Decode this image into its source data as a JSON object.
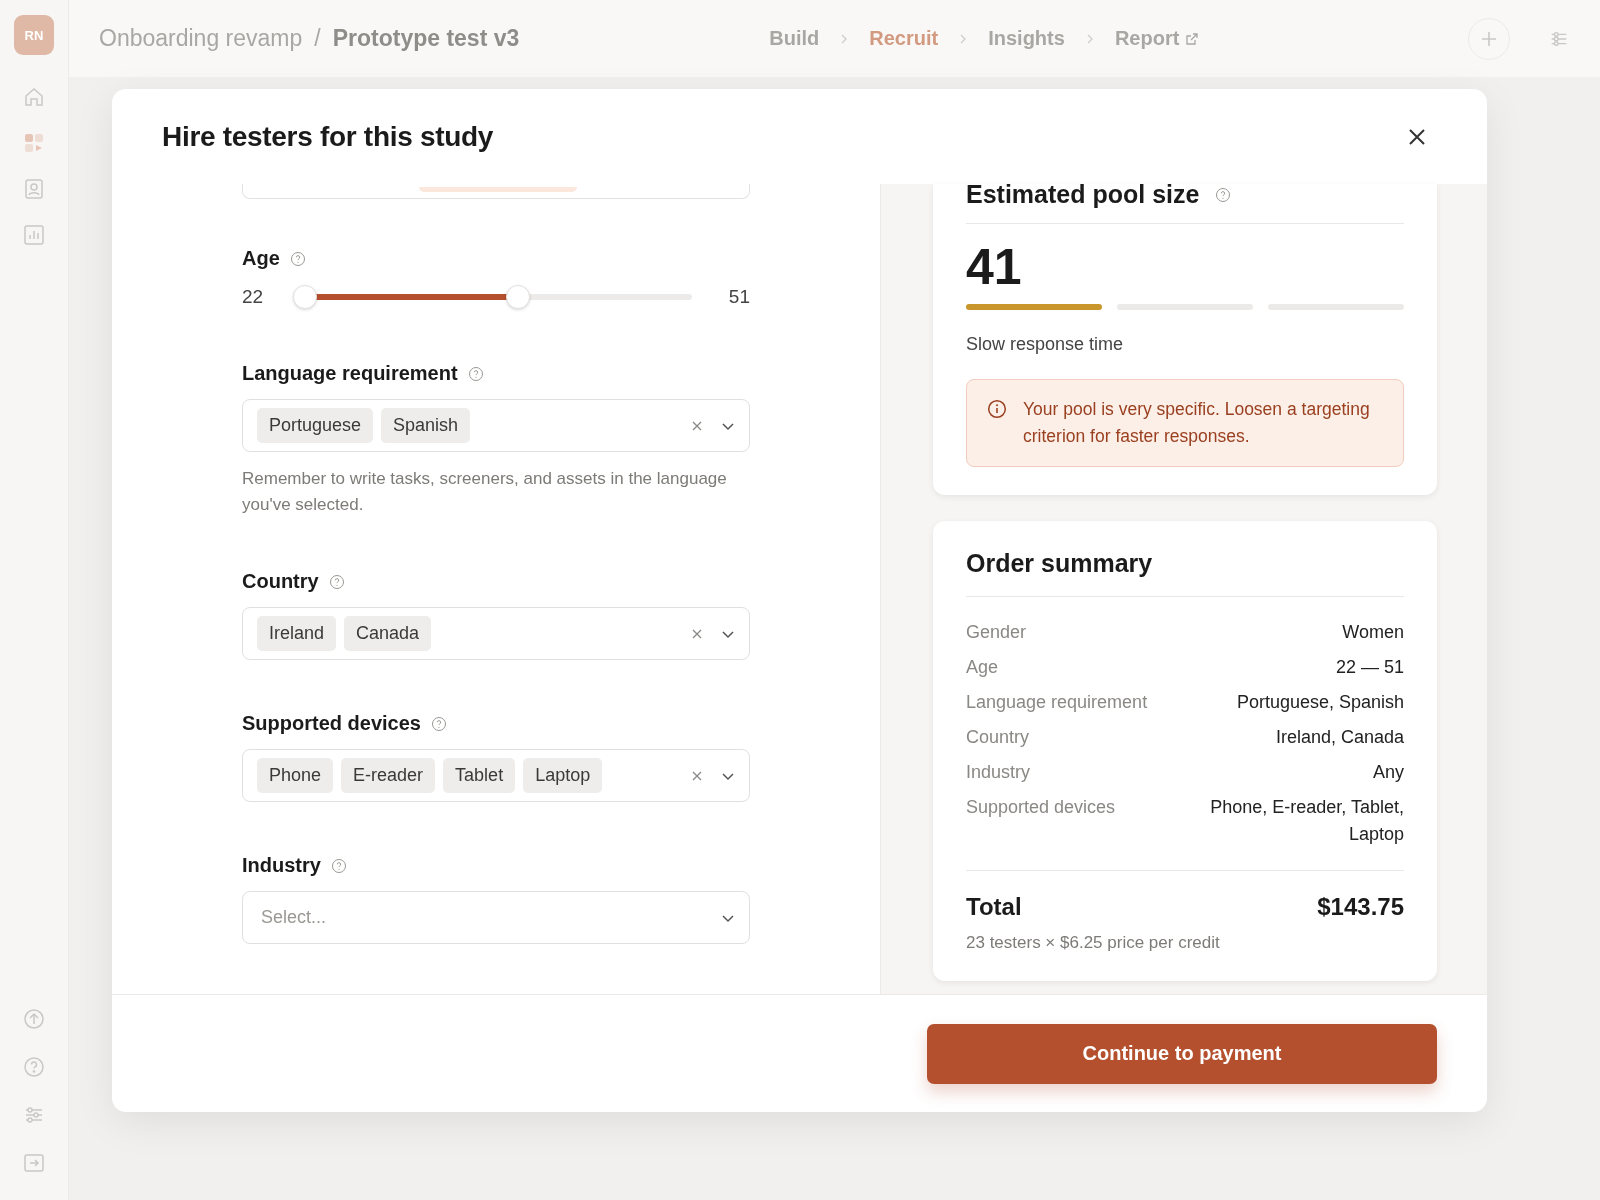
{
  "sidebar": {
    "avatar": "RN",
    "items": [
      {
        "kind": "home",
        "selected": false
      },
      {
        "kind": "grid",
        "selected": true
      },
      {
        "kind": "person",
        "selected": false
      },
      {
        "kind": "chart",
        "selected": false
      }
    ],
    "bottom_items": [
      {
        "kind": "upload"
      },
      {
        "kind": "help"
      },
      {
        "kind": "sliders"
      },
      {
        "kind": "exit"
      }
    ]
  },
  "breadcrumb": {
    "parent": "Onboarding revamp",
    "separator": "/",
    "current": "Prototype test v3"
  },
  "steps": [
    {
      "label": "Build",
      "selected": false,
      "external": false
    },
    {
      "label": "Recruit",
      "selected": true,
      "external": false
    },
    {
      "label": "Insights",
      "selected": false,
      "external": false
    },
    {
      "label": "Report",
      "selected": false,
      "external": true
    }
  ],
  "modal": {
    "title": "Hire testers for this study",
    "age": {
      "label": "Age",
      "min_label": "22",
      "max_label": "51",
      "level": 0.55
    },
    "fields": [
      {
        "label": "Language requirement",
        "tags": [
          "Portuguese",
          "Spanish"
        ],
        "hint": "Remember to write tasks, screeners, and assets in the language you've selected."
      },
      {
        "label": "Country",
        "tags": [
          "Ireland",
          "Canada"
        ]
      },
      {
        "label": "Supported devices",
        "tags": [
          "Phone",
          "E-reader",
          "Tablet",
          "Laptop"
        ]
      },
      {
        "label": "Industry",
        "placeholder": "Select..."
      }
    ],
    "pool": {
      "title": "Estimated pool size",
      "count": "41",
      "segments": [
        {
          "on": true
        },
        {
          "on": false
        },
        {
          "on": false
        }
      ],
      "speed": "Slow response time",
      "warning": "Your pool is very specific. Loosen a targeting criterion for faster responses."
    },
    "summary": {
      "title": "Order summary",
      "rows": [
        {
          "label": "Gender",
          "value": "Women"
        },
        {
          "label": "Age",
          "value": "22 — 51"
        },
        {
          "label": "Language requirement",
          "value": "Portuguese, Spanish"
        },
        {
          "label": "Country",
          "value": "Ireland, Canada"
        },
        {
          "label": "Industry",
          "value": "Any"
        },
        {
          "label": "Supported devices",
          "value": "Phone, E-reader, Tablet, Laptop"
        }
      ],
      "total_label": "Total",
      "total": "$143.75",
      "note": "23 testers × $6.25 price per credit"
    },
    "button": "Continue to payment"
  }
}
